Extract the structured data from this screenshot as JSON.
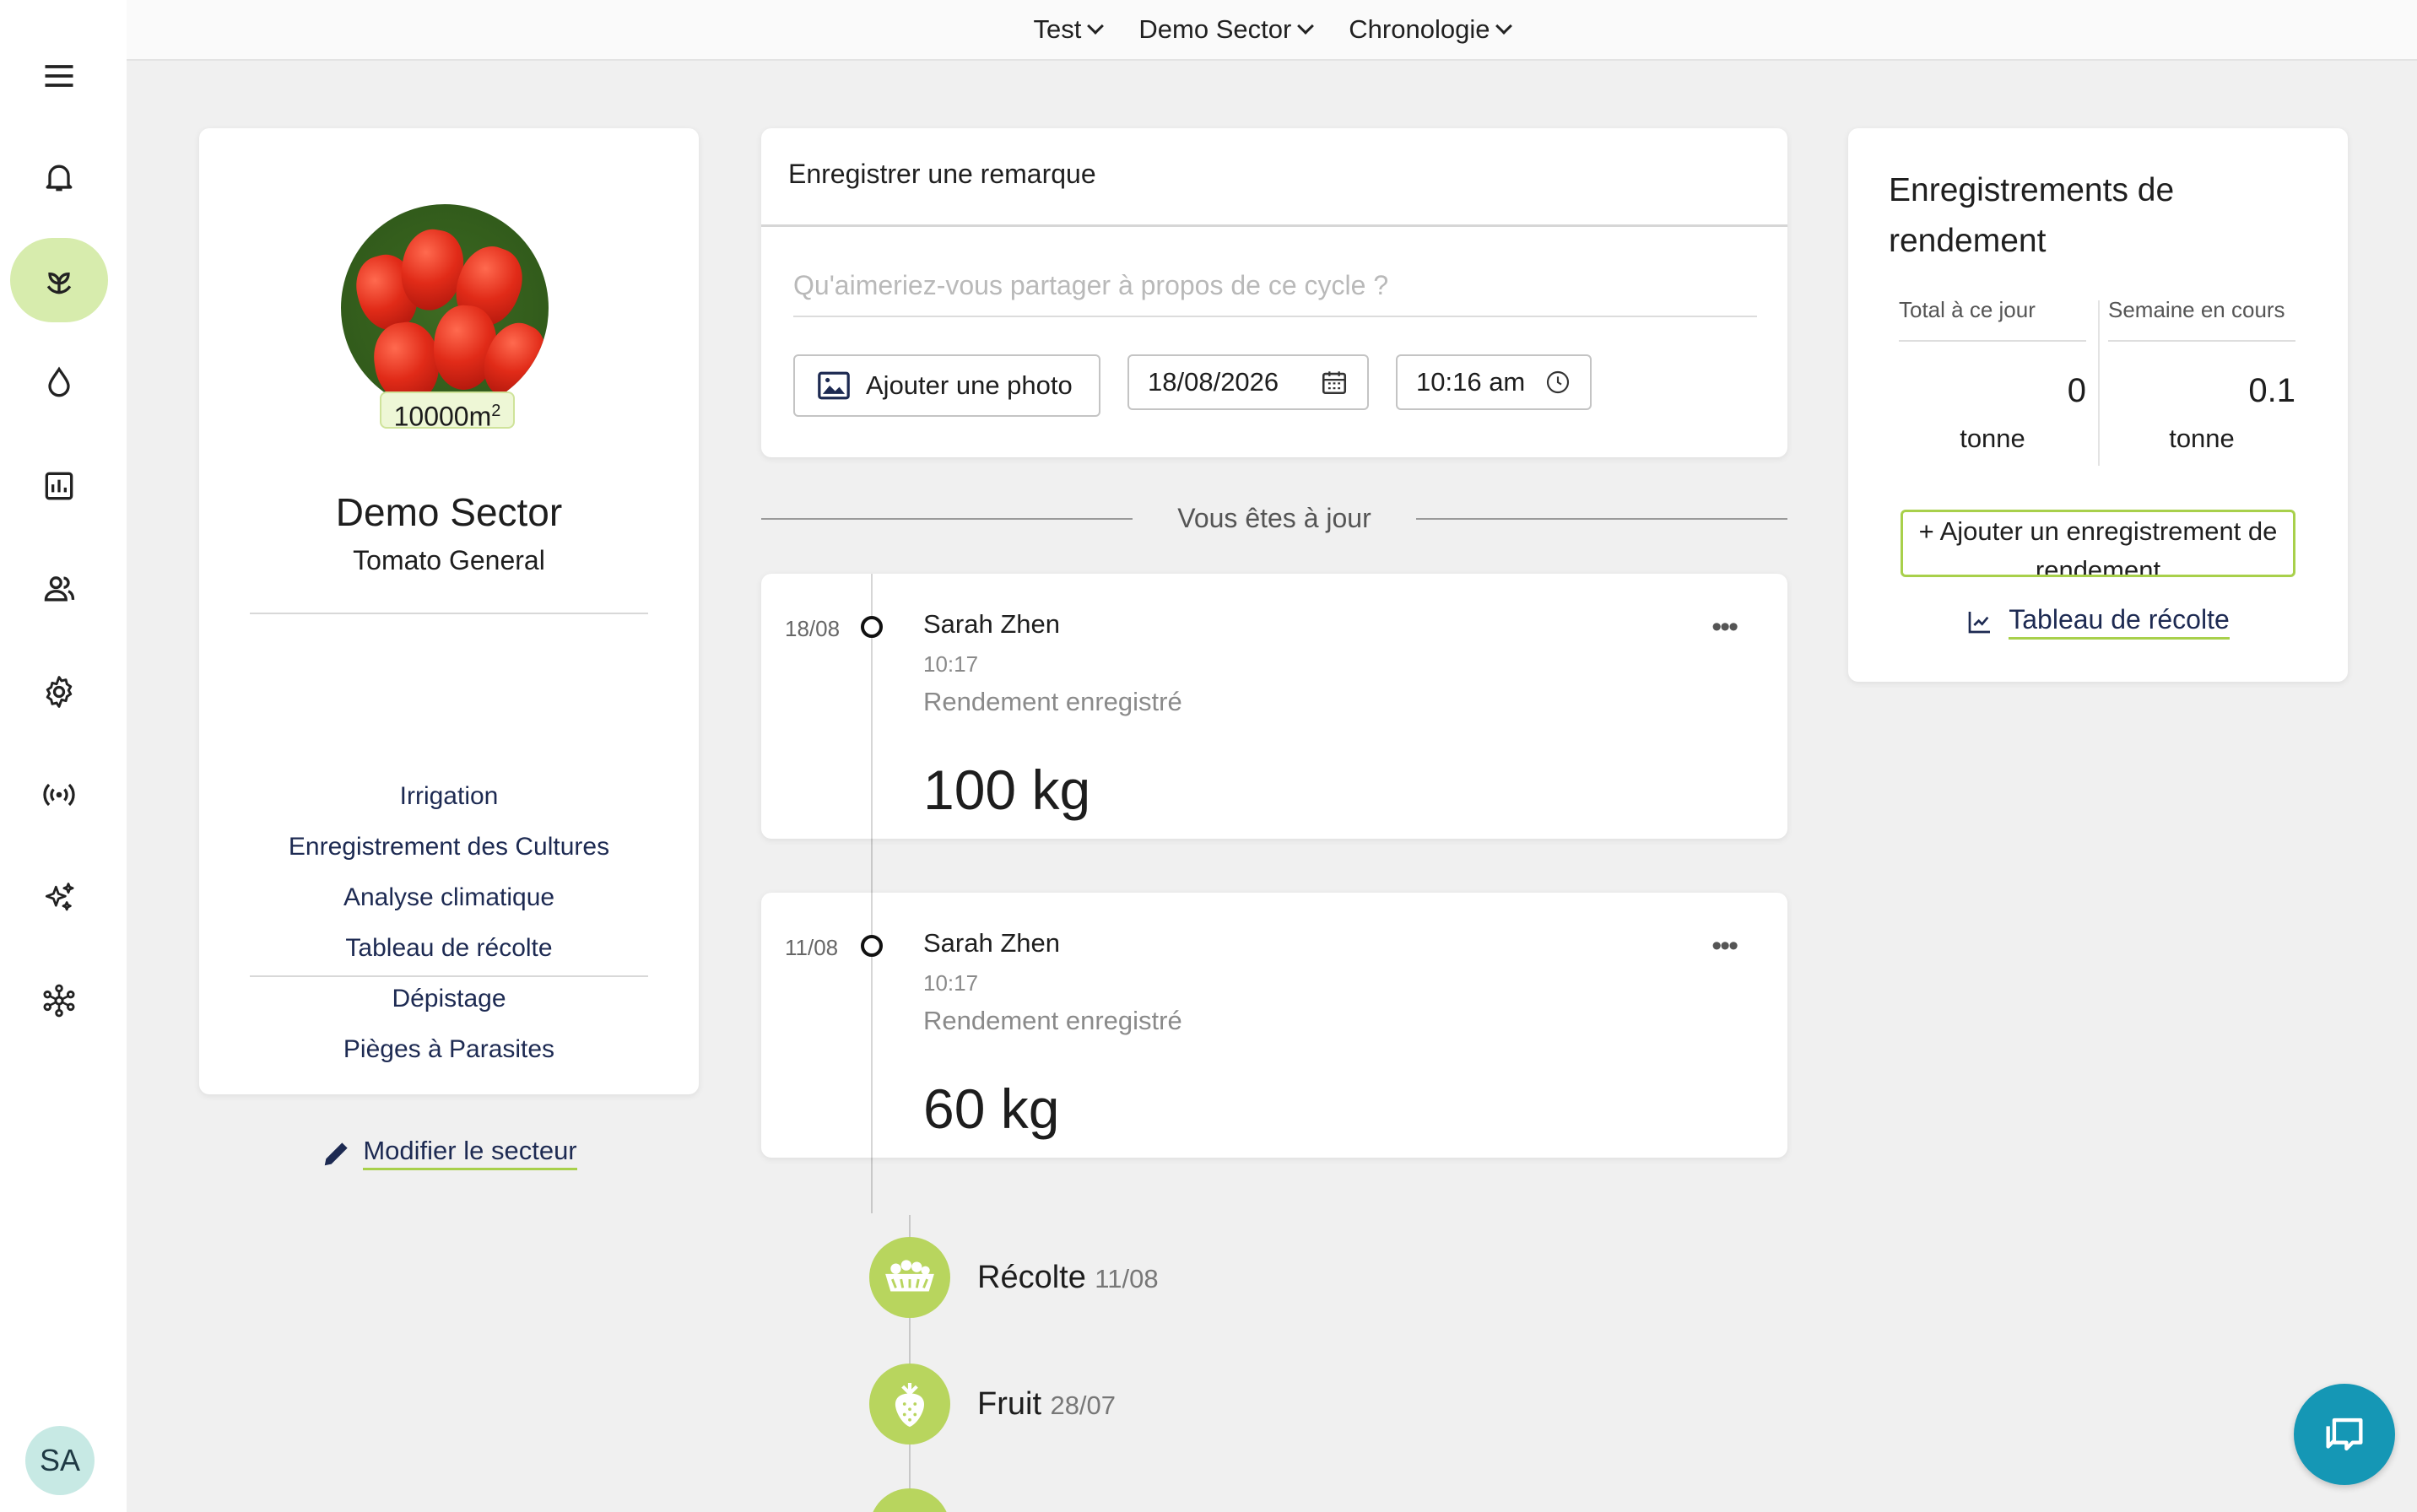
{
  "topbar": {
    "farm": "Test",
    "sector": "Demo Sector",
    "view": "Chronologie"
  },
  "sidebar": {
    "items": [
      {
        "icon": "menu-icon"
      },
      {
        "icon": "bell-icon"
      },
      {
        "icon": "sprout-icon",
        "active": true
      },
      {
        "icon": "water-drop-icon"
      },
      {
        "icon": "bar-chart-icon"
      },
      {
        "icon": "users-icon"
      },
      {
        "icon": "gear-icon"
      },
      {
        "icon": "signal-icon"
      },
      {
        "icon": "sparkles-icon"
      },
      {
        "icon": "network-icon"
      }
    ],
    "avatar": "SA"
  },
  "sector_card": {
    "area": "10000m",
    "area_exp": "2",
    "name": "Demo Sector",
    "crop": "Tomato General",
    "links": [
      "Irrigation",
      "Enregistrement des Cultures",
      "Analyse climatique",
      "Tableau de récolte",
      "Dépistage",
      "Pièges à Parasites"
    ],
    "edit_label": "Modifier le secteur"
  },
  "remark": {
    "title": "Enregistrer une remarque",
    "placeholder": "Qu'aimeriez-vous partager à propos de ce cycle ?",
    "photo_button": "Ajouter une photo",
    "date": "18/08/2026",
    "time": "10:16 am"
  },
  "timeline": {
    "uptodate": "Vous êtes à jour",
    "entries": [
      {
        "date": "18/08",
        "user": "Sarah Zhen",
        "time": "10:17",
        "kind": "Rendement enregistré",
        "value": "100 kg"
      },
      {
        "date": "11/08",
        "user": "Sarah Zhen",
        "time": "10:17",
        "kind": "Rendement enregistré",
        "value": "60 kg"
      }
    ],
    "stages": [
      {
        "name": "Récolte",
        "date": "11/08",
        "icon": "harvest-basket-icon"
      },
      {
        "name": "Fruit",
        "date": "28/07",
        "icon": "strawberry-icon"
      }
    ]
  },
  "yield": {
    "title": "Enregistrements de rendement",
    "total_label": "Total à ce jour",
    "week_label": "Semaine en cours",
    "total_value": "0",
    "week_value": "0.1",
    "unit": "tonne",
    "add_button": "+ Ajouter un enregistrement de rendement",
    "harvest_link": "Tableau de récolte"
  },
  "colors": {
    "accent": "#a8d04b",
    "active_nav": "#d7ecad",
    "stage_bubble": "#b8d55e",
    "chat_fab": "#1597b5",
    "link": "#1d2a52"
  }
}
